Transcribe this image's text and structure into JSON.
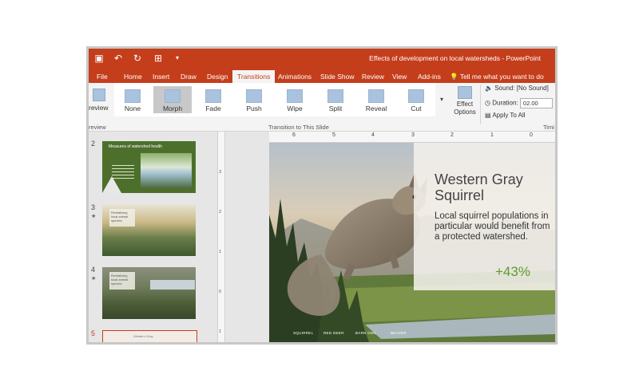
{
  "window": {
    "title": "Effects of development on local watersheds - PowerPoint"
  },
  "quick_access": [
    {
      "name": "save-icon",
      "glyph": "▣"
    },
    {
      "name": "undo-icon",
      "glyph": "↶"
    },
    {
      "name": "redo-icon",
      "glyph": "↻"
    },
    {
      "name": "start-from-beginning-icon",
      "glyph": "⊞"
    },
    {
      "name": "customize-toolbar-icon",
      "glyph": "▾"
    }
  ],
  "tabs": [
    "File",
    "Home",
    "Insert",
    "Draw",
    "Design",
    "Transitions",
    "Animations",
    "Slide Show",
    "Review",
    "View",
    "Add-ins"
  ],
  "active_tab": "Transitions",
  "tell_me": "Tell me what you want to do",
  "ribbon": {
    "preview_label": "review",
    "preview_group": "review",
    "transitions": [
      "None",
      "Morph",
      "Fade",
      "Push",
      "Wipe",
      "Split",
      "Reveal",
      "Cut"
    ],
    "selected_transition": "Morph",
    "gallery_group": "Transition to This Slide",
    "effect_options": "Effect Options",
    "sound_label": "Sound:",
    "sound_value": "[No Sound]",
    "duration_label": "Duration:",
    "duration_value": "02.00",
    "apply_to_all": "Apply To All",
    "timing_group": "Timi"
  },
  "thumbnails": {
    "slide2": {
      "number": "2",
      "title": "Measures of watershed health"
    },
    "slide3": {
      "number": "3",
      "star": "★",
      "caption": "Revitalizing local animal species"
    },
    "slide4": {
      "number": "4",
      "star": "★",
      "caption": "Revitalizing local animal species"
    },
    "slide5": {
      "number": "5",
      "caption": "Western Gray"
    }
  },
  "ruler": {
    "horizontal": [
      "6",
      "5",
      "4",
      "3",
      "2",
      "1",
      "0"
    ],
    "vertical": [
      "3",
      "2",
      "1",
      "0",
      "1"
    ]
  },
  "slide": {
    "heading": "Western Gray Squirrel",
    "body": "Local squirrel populations in particular would benefit from a protected watershed.",
    "stat": "+43%",
    "captions": [
      "SQUIRREL",
      "RED DEER",
      "BARN OWL",
      "BEAVER"
    ]
  },
  "colors": {
    "accent": "#c43e1c",
    "stat": "#5a9e2b"
  }
}
